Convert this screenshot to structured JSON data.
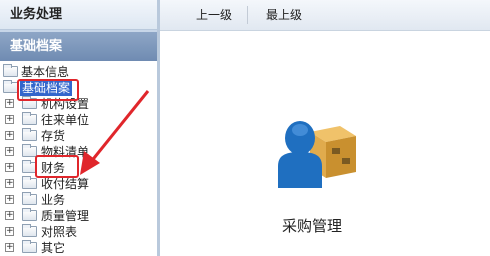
{
  "sidebar": {
    "header": "业务处理",
    "section": "基础档案",
    "tree": [
      {
        "label": "基本信息",
        "level": 0,
        "expander": "",
        "selected": false
      },
      {
        "label": "基础档案",
        "level": 0,
        "expander": "",
        "selected": true
      },
      {
        "label": "机构设置",
        "level": 1,
        "expander": "+",
        "selected": false
      },
      {
        "label": "往来单位",
        "level": 1,
        "expander": "+",
        "selected": false
      },
      {
        "label": "存货",
        "level": 1,
        "expander": "+",
        "selected": false
      },
      {
        "label": "物料清单",
        "level": 1,
        "expander": "+",
        "selected": false
      },
      {
        "label": "财务",
        "level": 1,
        "expander": "+",
        "selected": false
      },
      {
        "label": "收付结算",
        "level": 1,
        "expander": "+",
        "selected": false
      },
      {
        "label": "业务",
        "level": 1,
        "expander": "+",
        "selected": false
      },
      {
        "label": "质量管理",
        "level": 1,
        "expander": "+",
        "selected": false
      },
      {
        "label": "对照表",
        "level": 1,
        "expander": "+",
        "selected": false
      },
      {
        "label": "其它",
        "level": 1,
        "expander": "+",
        "selected": false
      }
    ]
  },
  "toolbar": {
    "up_label": "上一级",
    "top_label": "最上级"
  },
  "main": {
    "module_label": "采购管理",
    "module_icon": "purchase-person-box-icon"
  },
  "colors": {
    "selection": "#3366cc",
    "annotation": "#e0262b",
    "person_blue": "#1f6fc0",
    "box_tan": "#d9a441"
  }
}
